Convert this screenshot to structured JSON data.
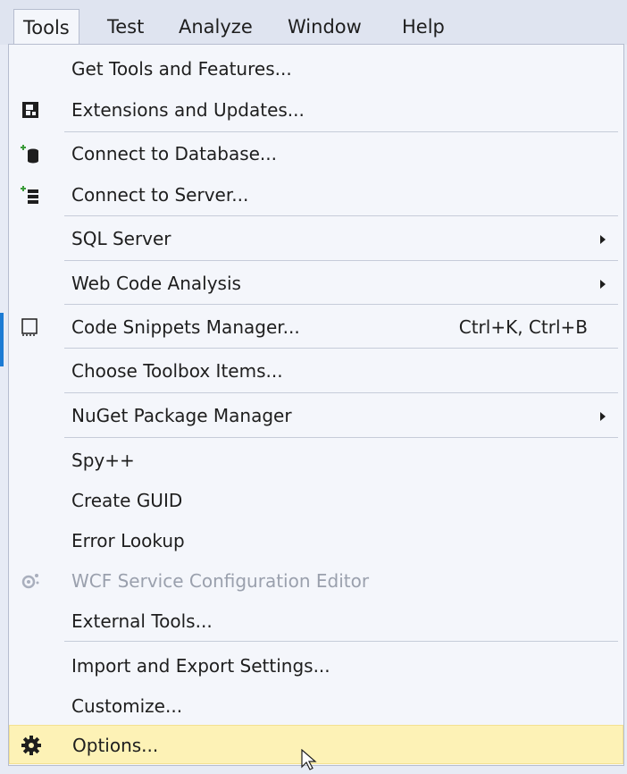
{
  "menubar": {
    "items": [
      {
        "label": "Tools"
      },
      {
        "label": "Test"
      },
      {
        "label": "Analyze"
      },
      {
        "label": "Window"
      },
      {
        "label": "Help"
      }
    ]
  },
  "menu": {
    "items": [
      {
        "label": "Get Tools and Features..."
      },
      {
        "label": "Extensions and Updates...",
        "icon": "extensions-icon"
      },
      {
        "label": "Connect to Database...",
        "icon": "database-icon"
      },
      {
        "label": "Connect to Server...",
        "icon": "server-icon"
      },
      {
        "label": "SQL Server",
        "submenu": true
      },
      {
        "label": "Web Code Analysis",
        "submenu": true
      },
      {
        "label": "Code Snippets Manager...",
        "shortcut": "Ctrl+K, Ctrl+B",
        "icon": "snippet-icon"
      },
      {
        "label": "Choose Toolbox Items..."
      },
      {
        "label": "NuGet Package Manager",
        "submenu": true
      },
      {
        "label": "Spy++"
      },
      {
        "label": "Create GUID"
      },
      {
        "label": "Error Lookup"
      },
      {
        "label": "WCF Service Configuration Editor",
        "icon": "wcf-config-icon",
        "disabled": true
      },
      {
        "label": "External Tools..."
      },
      {
        "label": "Import and Export Settings..."
      },
      {
        "label": "Customize..."
      },
      {
        "label": "Options...",
        "icon": "gear-icon",
        "highlighted": true
      }
    ]
  },
  "colors": {
    "highlight": "#fdf2b6",
    "menu_background": "#f4f6fb",
    "disabled_text": "#9aa0ad"
  }
}
